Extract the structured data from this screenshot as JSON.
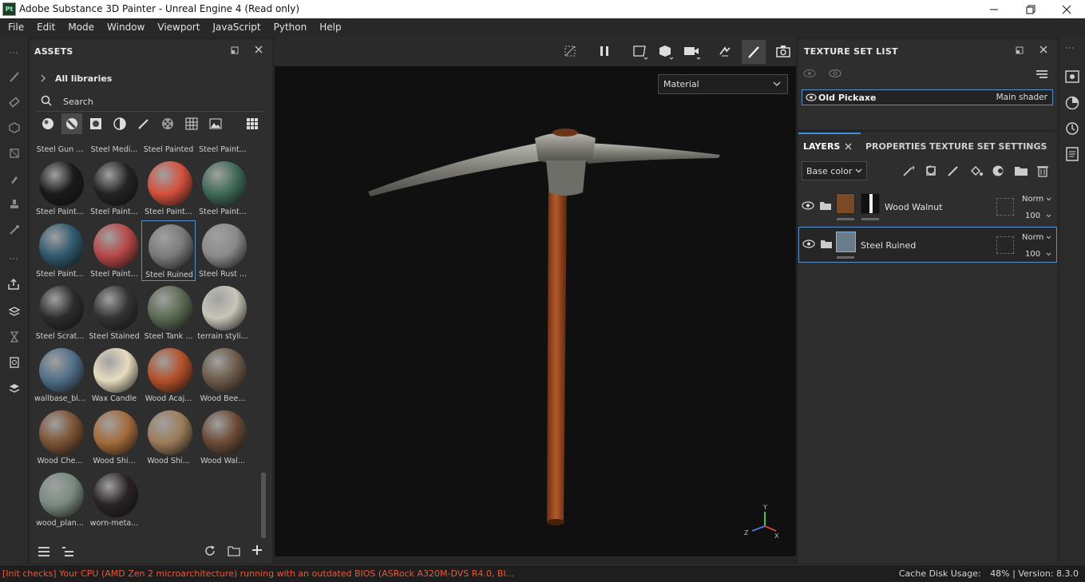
{
  "window": {
    "app_icon": "Pt",
    "title": "Adobe Substance 3D Painter - Unreal Engine 4 (Read only)"
  },
  "menu": [
    "File",
    "Edit",
    "Mode",
    "Window",
    "Viewport",
    "JavaScript",
    "Python",
    "Help"
  ],
  "assets": {
    "title": "ASSETS",
    "breadcrumb": "All libraries",
    "search_placeholder": "Search",
    "materials": [
      {
        "label": "Steel Gun ...",
        "color": "#3a3a3a"
      },
      {
        "label": "Steel Medi...",
        "color": "#3d4a4b"
      },
      {
        "label": "Steel Painted",
        "color": "#b03228"
      },
      {
        "label": "Steel Paint...",
        "color": "#9a3a33"
      },
      {
        "label": "Steel Paint...",
        "color": "#1a1a1a"
      },
      {
        "label": "Steel Paint...",
        "color": "#242424"
      },
      {
        "label": "Steel Paint...",
        "color": "#d4503d"
      },
      {
        "label": "Steel Paint...",
        "color": "#3f6a58"
      },
      {
        "label": "Steel Paint...",
        "color": "#2f5a6e"
      },
      {
        "label": "Steel Paint...",
        "color": "#b74848"
      },
      {
        "label": "Steel Ruined",
        "color": "#7a7a7a"
      },
      {
        "label": "Steel Rust ...",
        "color": "#8a8a8a"
      },
      {
        "label": "Steel Scrat...",
        "color": "#2c2c2c"
      },
      {
        "label": "Steel Stained",
        "color": "#333333"
      },
      {
        "label": "Steel Tank ...",
        "color": "#5b6a52"
      },
      {
        "label": "terrain styli...",
        "color": "#c8c4b8"
      },
      {
        "label": "wallbase_bl...",
        "color": "#4f6f87"
      },
      {
        "label": "Wax Candle",
        "color": "#e7dcc0"
      },
      {
        "label": "Wood Acaj...",
        "color": "#b4502a"
      },
      {
        "label": "Wood Bee...",
        "color": "#6c5a49"
      },
      {
        "label": "Wood Che...",
        "color": "#7c5334"
      },
      {
        "label": "Wood Shi...",
        "color": "#a36b3d"
      },
      {
        "label": "Wood Shi...",
        "color": "#9c7c5a"
      },
      {
        "label": "Wood Wal...",
        "color": "#6a4a36"
      },
      {
        "label": "wood_plan...",
        "color": "#7a8a7f"
      },
      {
        "label": "worn-meta...",
        "color": "#2a2226"
      }
    ],
    "selected_index": 10
  },
  "viewport": {
    "material_mode": "Material",
    "axis_labels": {
      "x": "X",
      "y": "Y",
      "z": "Z"
    }
  },
  "texture_set_list": {
    "title": "TEXTURE SET LIST",
    "item_name": "Old Pickaxe",
    "item_shader": "Main shader"
  },
  "layers_panel": {
    "tabs": [
      "LAYERS",
      "PROPERTIES",
      "TEXTURE SET SETTINGS"
    ],
    "channel": "Base color",
    "layers": [
      {
        "name": "Wood Walnut",
        "blend": "Norm",
        "opacity": "100"
      },
      {
        "name": "Steel Ruined",
        "blend": "Norm",
        "opacity": "100"
      }
    ]
  },
  "status": {
    "error": "[Init checks] Your CPU (AMD Zen 2 microarchitecture) running with an outdated BIOS (ASRock A320M-DVS R4.0, BI...",
    "cache_label": "Cache Disk Usage:",
    "cache_value": "48%",
    "version": "Version: 8.3.0"
  },
  "colors": {
    "accent": "#3d8fe0",
    "error": "#e8593c",
    "selection": "#5a8fd0"
  }
}
